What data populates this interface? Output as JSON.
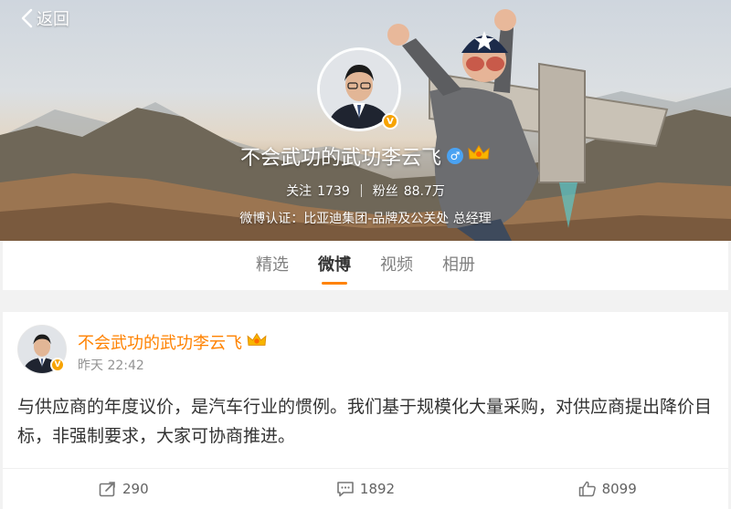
{
  "header": {
    "back_label": "返回",
    "profile_name": "不会武功的武功李云飞",
    "verified_badge": "V",
    "gender_symbol": "♂",
    "following_label": "关注",
    "following_count": "1739",
    "followers_label": "粉丝",
    "followers_count": "88.7万",
    "verification": "微博认证：比亚迪集团-品牌及公关处 总经理"
  },
  "tabs": [
    {
      "label": "精选"
    },
    {
      "label": "微博"
    },
    {
      "label": "视频"
    },
    {
      "label": "相册"
    }
  ],
  "active_tab": "微博",
  "post": {
    "author": "不会武功的武功李云飞",
    "time": "昨天 22:42",
    "text": "与供应商的年度议价，是汽车行业的惯例。我们基于规模化大量采购，对供应商提出降价目标，非强制要求，大家可协商推进。",
    "reposts": "290",
    "comments": "1892",
    "likes": "8099"
  },
  "colors": {
    "accent": "#ff8200",
    "verified": "#f7a300",
    "gender": "#4aa2f2"
  }
}
